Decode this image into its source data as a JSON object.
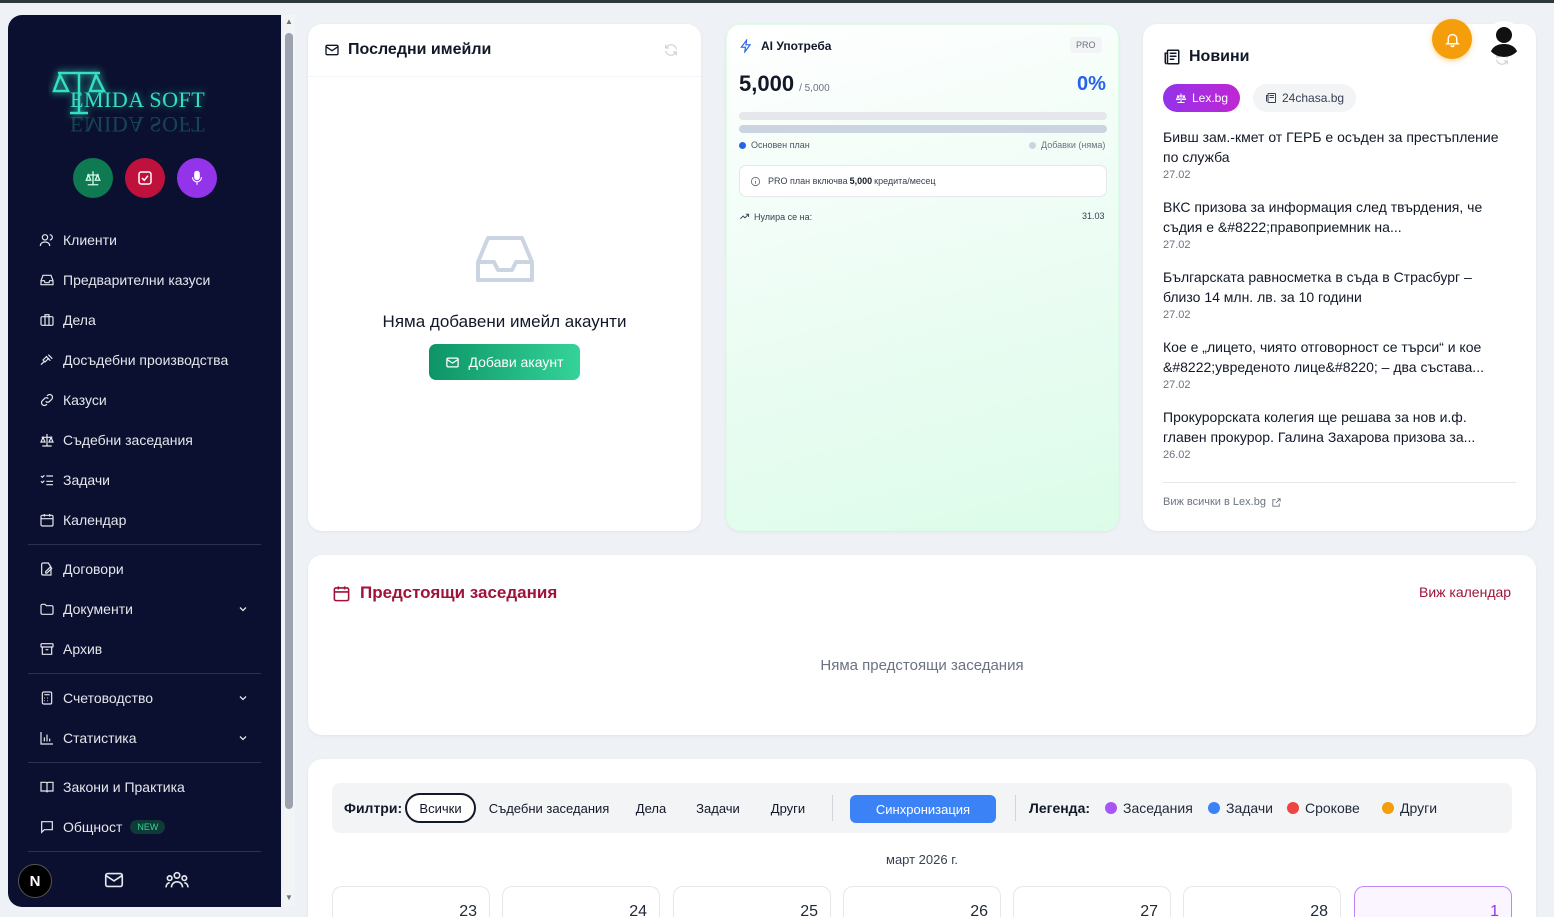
{
  "app": {
    "logo_text": "EMIDA SOFT"
  },
  "sidebar": {
    "items": [
      {
        "label": "Клиенти",
        "icon": "users-icon"
      },
      {
        "label": "Предварителни казуси",
        "icon": "inbox-icon"
      },
      {
        "label": "Дела",
        "icon": "briefcase-icon"
      },
      {
        "label": "Досъдебни производства",
        "icon": "gavel-icon"
      },
      {
        "label": "Казуси",
        "icon": "link-icon"
      },
      {
        "label": "Съдебни заседания",
        "icon": "scales-icon"
      },
      {
        "label": "Задачи",
        "icon": "list-check-icon"
      },
      {
        "label": "Календар",
        "icon": "calendar-icon"
      },
      {
        "label": "Договори",
        "icon": "contract-icon"
      },
      {
        "label": "Документи",
        "icon": "folder-icon"
      },
      {
        "label": "Архив",
        "icon": "archive-icon"
      },
      {
        "label": "Счетоводство",
        "icon": "calculator-icon"
      },
      {
        "label": "Статистика",
        "icon": "bar-chart-icon"
      },
      {
        "label": "Закони и Практика",
        "icon": "book-icon"
      },
      {
        "label": "Общност",
        "icon": "chat-icon",
        "badge": "NEW"
      }
    ]
  },
  "emails": {
    "title": "Последни имейли",
    "empty_text": "Няма добавени имейл акаунти",
    "add_button": "Добави акаунт"
  },
  "ai": {
    "title": "AI Употреба",
    "plan_badge": "PRO",
    "used": "5,000",
    "limit": "/ 5,000",
    "percent": "0%",
    "percent_value": 0,
    "legend_base": "Основен план",
    "legend_addon": "Добавки (няма)",
    "info_prefix": "PRO план включва ",
    "info_credits": "5,000",
    "info_suffix": " кредита/месец",
    "reset_label": "Нулира се на:",
    "reset_date": "31.03"
  },
  "news": {
    "title": "Новини",
    "sources": [
      "Lex.bg",
      "24chasa.bg"
    ],
    "items": [
      {
        "headline": "Бивш зам.-кмет от ГЕРБ е осъден за престъпление по служба",
        "date": "27.02"
      },
      {
        "headline": "ВКС призова за информация след твърдения, че съдия е &#8222;правоприемник на...",
        "date": "27.02"
      },
      {
        "headline": "Българската равносметка в съда в Страсбург – близо 14 млн. лв. за 10 години",
        "date": "27.02"
      },
      {
        "headline": "Кое е „лицето, чиято отговорност се търси“ и кое &#8222;увреденото лице&#8220; – два състава...",
        "date": "27.02"
      },
      {
        "headline": "Прокурорската колегия ще решава за нов и.ф. главен прокурор. Галина Захарова призова за...",
        "date": "26.02"
      }
    ],
    "view_all": "Виж всички в Lex.bg"
  },
  "hearings": {
    "title": "Предстоящи заседания",
    "view_calendar": "Виж календар",
    "empty_text": "Няма предстоящи заседания"
  },
  "calendar": {
    "filters_label": "Филтри:",
    "filters": [
      "Всички",
      "Съдебни заседания",
      "Дела",
      "Задачи",
      "Други"
    ],
    "sync_button": "Синхронизация",
    "legend_label": "Легенда:",
    "legend": [
      {
        "label": "Заседания",
        "color": "#a855f7"
      },
      {
        "label": "Задачи",
        "color": "#3b82f6"
      },
      {
        "label": "Срокове",
        "color": "#ef4444"
      },
      {
        "label": "Други",
        "color": "#f59e0b"
      }
    ],
    "month_label": "март 2026 г.",
    "days": [
      "23",
      "24",
      "25",
      "26",
      "27",
      "28",
      "1"
    ]
  },
  "colors": {
    "sidebar_bg": "#0b1030",
    "accent_green": "#10b981",
    "accent_purple": "#9333ea",
    "hearing_red": "#9f1239",
    "sync_blue": "#3b82f6"
  }
}
